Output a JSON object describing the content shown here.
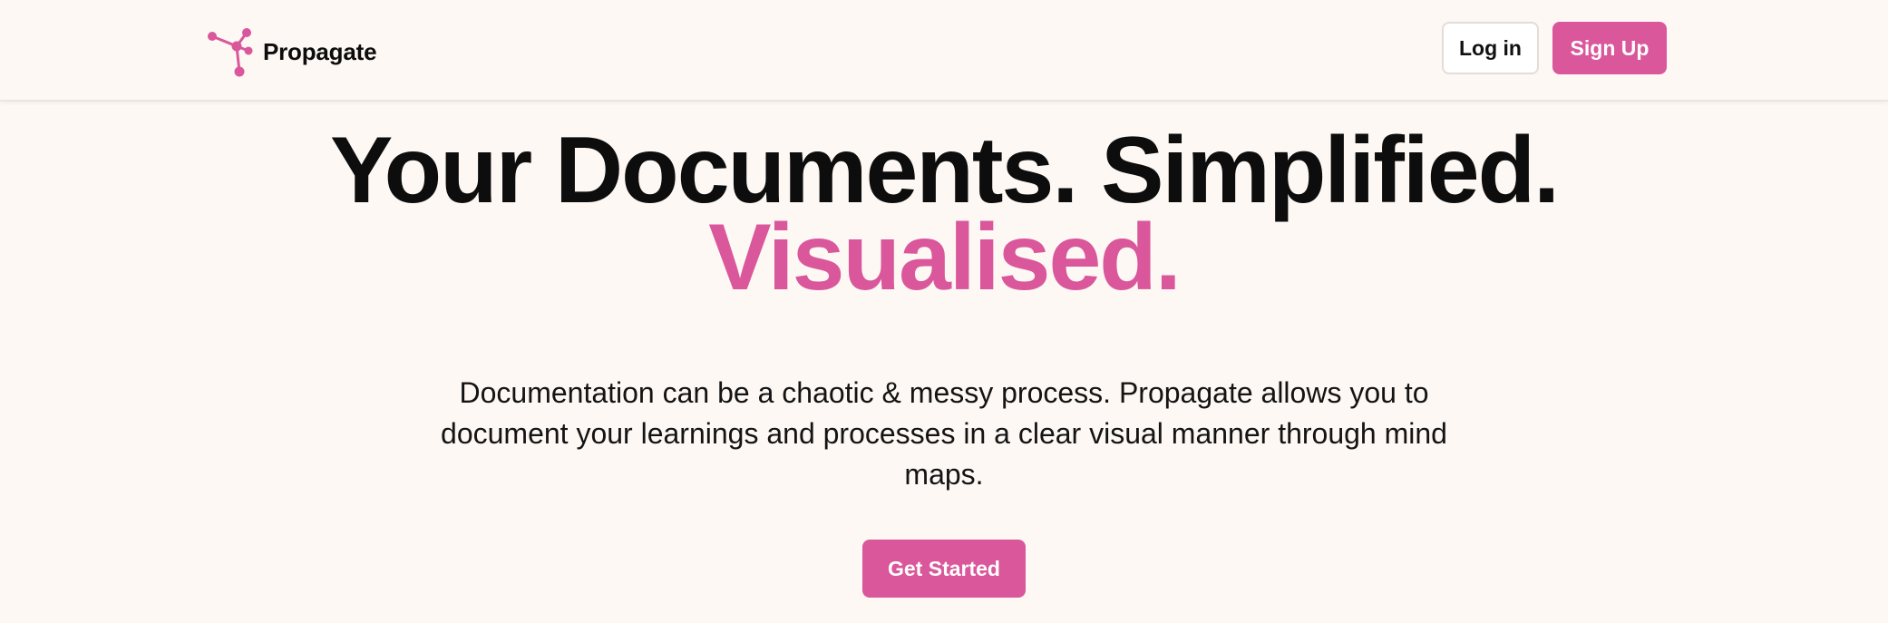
{
  "header": {
    "brand": "Propagate",
    "logo_icon": "network-nodes-icon",
    "login_label": "Log in",
    "signup_label": "Sign Up"
  },
  "hero": {
    "title_line1": "Your Documents. Simplified.",
    "title_line2": "Visualised.",
    "description": "Documentation can be a chaotic & messy process. Propagate allows you to document your learnings and processes in a clear visual manner through mind maps.",
    "cta_label": "Get Started"
  },
  "colors": {
    "accent": "#d9579a",
    "background": "#fdf8f4",
    "text": "#0d0d0d"
  }
}
